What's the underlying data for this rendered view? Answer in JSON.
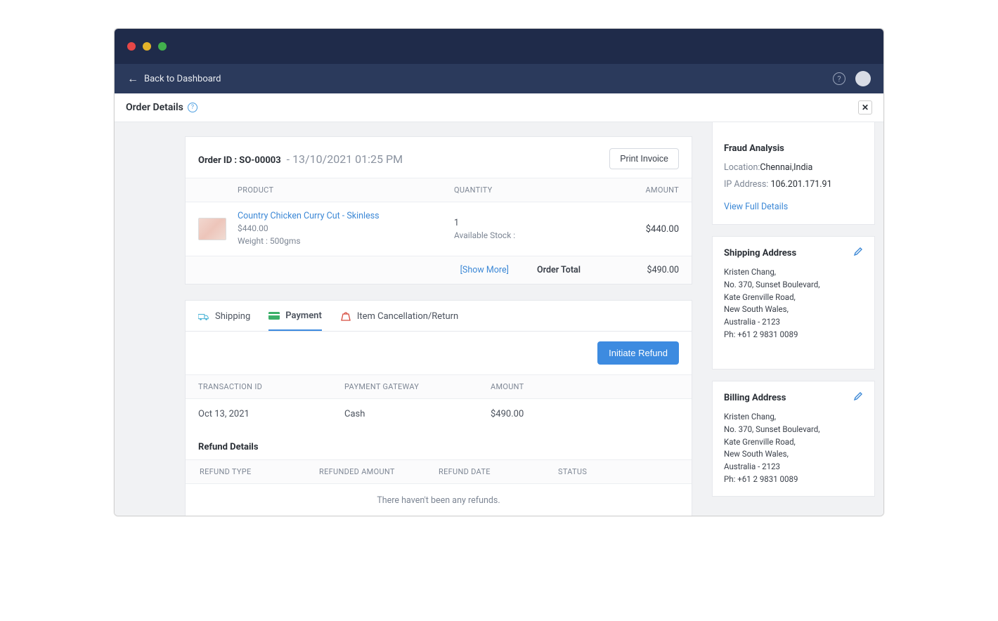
{
  "toolbar": {
    "back_label": "Back to Dashboard"
  },
  "header": {
    "title": "Order Details"
  },
  "order": {
    "id_label": "Order ID : SO-00003",
    "date": "- 13/10/2021 01:25 PM",
    "print_label": "Print Invoice",
    "columns": {
      "product": "PRODUCT",
      "quantity": "QUANTITY",
      "amount": "AMOUNT"
    },
    "items": [
      {
        "name": "Country Chicken Curry Cut - Skinless",
        "price": "$440.00",
        "weight": "Weight : 500gms",
        "qty": "1",
        "stock_label": "Available Stock :",
        "amount": "$440.00"
      }
    ],
    "show_more": "[Show More]",
    "total_label": "Order Total",
    "total_value": "$490.00"
  },
  "tabs": {
    "shipping": "Shipping",
    "payment": "Payment",
    "cancel": "Item Cancellation/Return",
    "initiate_refund": "Initiate Refund"
  },
  "transactions": {
    "columns": {
      "id": "TRANSACTION ID",
      "gateway": "PAYMENT GATEWAY",
      "amount": "AMOUNT"
    },
    "rows": [
      {
        "date": "Oct 13, 2021",
        "gateway": "Cash",
        "amount": "$490.00"
      }
    ]
  },
  "refund": {
    "title": "Refund Details",
    "columns": {
      "type": "REFUND TYPE",
      "amount": "REFUNDED AMOUNT",
      "date": "REFUND DATE",
      "status": "STATUS"
    },
    "empty": "There haven't been any refunds."
  },
  "fraud": {
    "title": "Fraud Analysis",
    "location_label": "Location:",
    "location_value": "Chennai,India",
    "ip_label": "IP Address:",
    "ip_value": "106.201.171.91",
    "view_full": "View Full Details"
  },
  "shipping_address": {
    "title": "Shipping Address",
    "lines": [
      "Kristen Chang,",
      "No. 370, Sunset Boulevard,",
      "Kate Grenville Road,",
      "New South Wales,",
      "Australia - 2123",
      "Ph: +61 2 9831 0089"
    ]
  },
  "billing_address": {
    "title": "Billing Address",
    "lines": [
      "Kristen Chang,",
      "No. 370, Sunset Boulevard,",
      "Kate Grenville Road,",
      "New South Wales,",
      "Australia - 2123",
      "Ph: +61 2 9831 0089"
    ]
  }
}
